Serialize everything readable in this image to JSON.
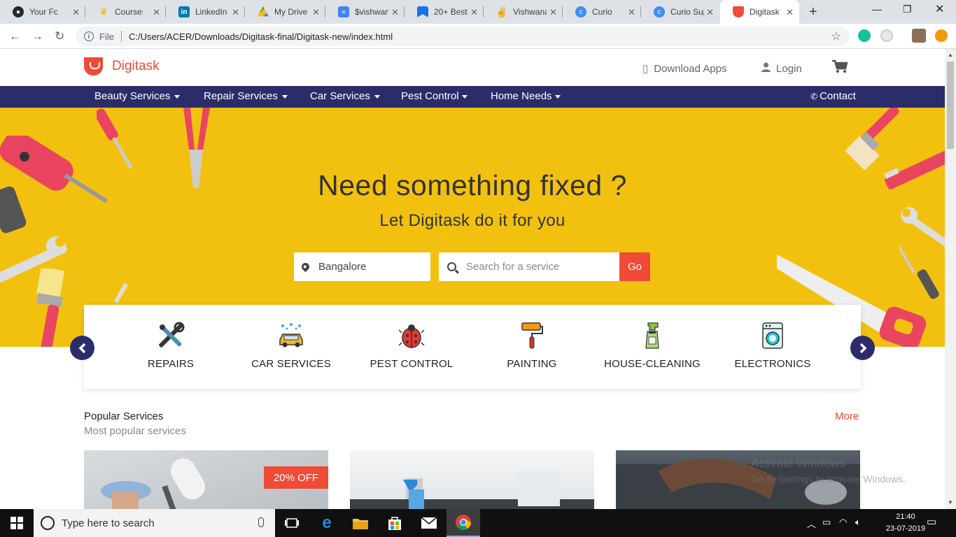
{
  "browser": {
    "tabs": [
      {
        "title": "Your Follo",
        "icon": "github-icon",
        "color": "#24292e"
      },
      {
        "title": "Courses D",
        "icon": "crown-icon",
        "color": "#f4b400"
      },
      {
        "title": "LinkedIn",
        "icon": "linkedin-icon",
        "color": "#0077b5"
      },
      {
        "title": "My Drive",
        "icon": "drive-icon",
        "color": "#34a853"
      },
      {
        "title": "$vishwan",
        "icon": "docs-icon",
        "color": "#4285f4"
      },
      {
        "title": "20+ Best",
        "icon": "bookmark-icon",
        "color": "#1a73e8"
      },
      {
        "title": "Vishwana",
        "icon": "angellist-icon",
        "color": "#333333"
      },
      {
        "title": "Curio",
        "icon": "curio-icon",
        "color": "#3d8bfd"
      },
      {
        "title": "Curio Sup",
        "icon": "curio-icon",
        "color": "#3d8bfd"
      },
      {
        "title": "Digitask",
        "icon": "digitask-icon",
        "color": "#ef4b36"
      }
    ],
    "address": {
      "scheme_label": "File",
      "url": "C:/Users/ACER/Downloads/Digitask-final/Digitask-new/index.html"
    }
  },
  "header": {
    "brand": "Digitask",
    "download_apps": "Download Apps",
    "login": "Login"
  },
  "nav": {
    "items": [
      {
        "label": "Beauty Services"
      },
      {
        "label": "Repair Services"
      },
      {
        "label": "Car Services"
      },
      {
        "label": "Pest Control"
      },
      {
        "label": "Home Needs"
      }
    ],
    "contact": "Contact"
  },
  "hero": {
    "title": "Need something fixed ?",
    "subtitle": "Let Digitask do it for you",
    "location_value": "Bangalore",
    "search_placeholder": "Search for a service",
    "go_label": "Go"
  },
  "categories": [
    {
      "label": "REPAIRS",
      "icon": "tools-icon"
    },
    {
      "label": "CAR SERVICES",
      "icon": "car-wash-icon"
    },
    {
      "label": "PEST CONTROL",
      "icon": "bug-icon"
    },
    {
      "label": "PAINTING",
      "icon": "paint-roller-icon"
    },
    {
      "label": "HOUSE-CLEANING",
      "icon": "spray-bottle-icon"
    },
    {
      "label": "ELECTRONICS",
      "icon": "washing-machine-icon"
    }
  ],
  "popular": {
    "title": "Popular Services",
    "subtitle": "Most popular services",
    "more": "More",
    "discount": "20% OFF"
  },
  "windows": {
    "watermark_title": "Activate Windows",
    "watermark_sub": "Go to Settings to activate Windows.",
    "search_placeholder": "Type here to search",
    "time": "21:40",
    "date": "23-07-2019"
  },
  "colors": {
    "brand": "#ef4b36",
    "nav": "#2b2d6b",
    "hero": "#f2c10f"
  }
}
